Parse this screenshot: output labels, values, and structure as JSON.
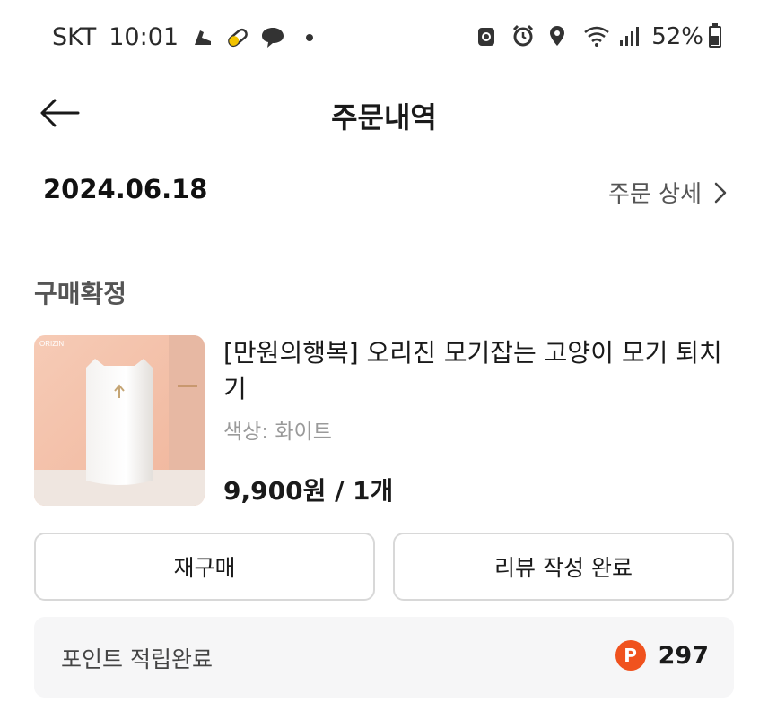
{
  "status_bar": {
    "carrier": "SKT",
    "time": "10:01",
    "battery": "52%",
    "battery_level": 0.52
  },
  "header": {
    "title": "주문내역"
  },
  "order": {
    "date": "2024.06.18",
    "detail_link": "주문 상세",
    "status": "구매확정"
  },
  "product": {
    "name": "[만원의행복] 오리진 모기잡는 고양이 모기 퇴치기",
    "option": "색상: 화이트",
    "price_qty": "9,900원 / 1개",
    "brand_mark": "ORIZIN"
  },
  "actions": {
    "rebuy_label": "재구매",
    "review_label": "리뷰 작성 완료"
  },
  "points": {
    "label": "포인트 적립완료",
    "icon_letter": "P",
    "value": "297"
  },
  "colors": {
    "points_accent": "#f0521e",
    "thumb_background": "#f3c3ad"
  }
}
